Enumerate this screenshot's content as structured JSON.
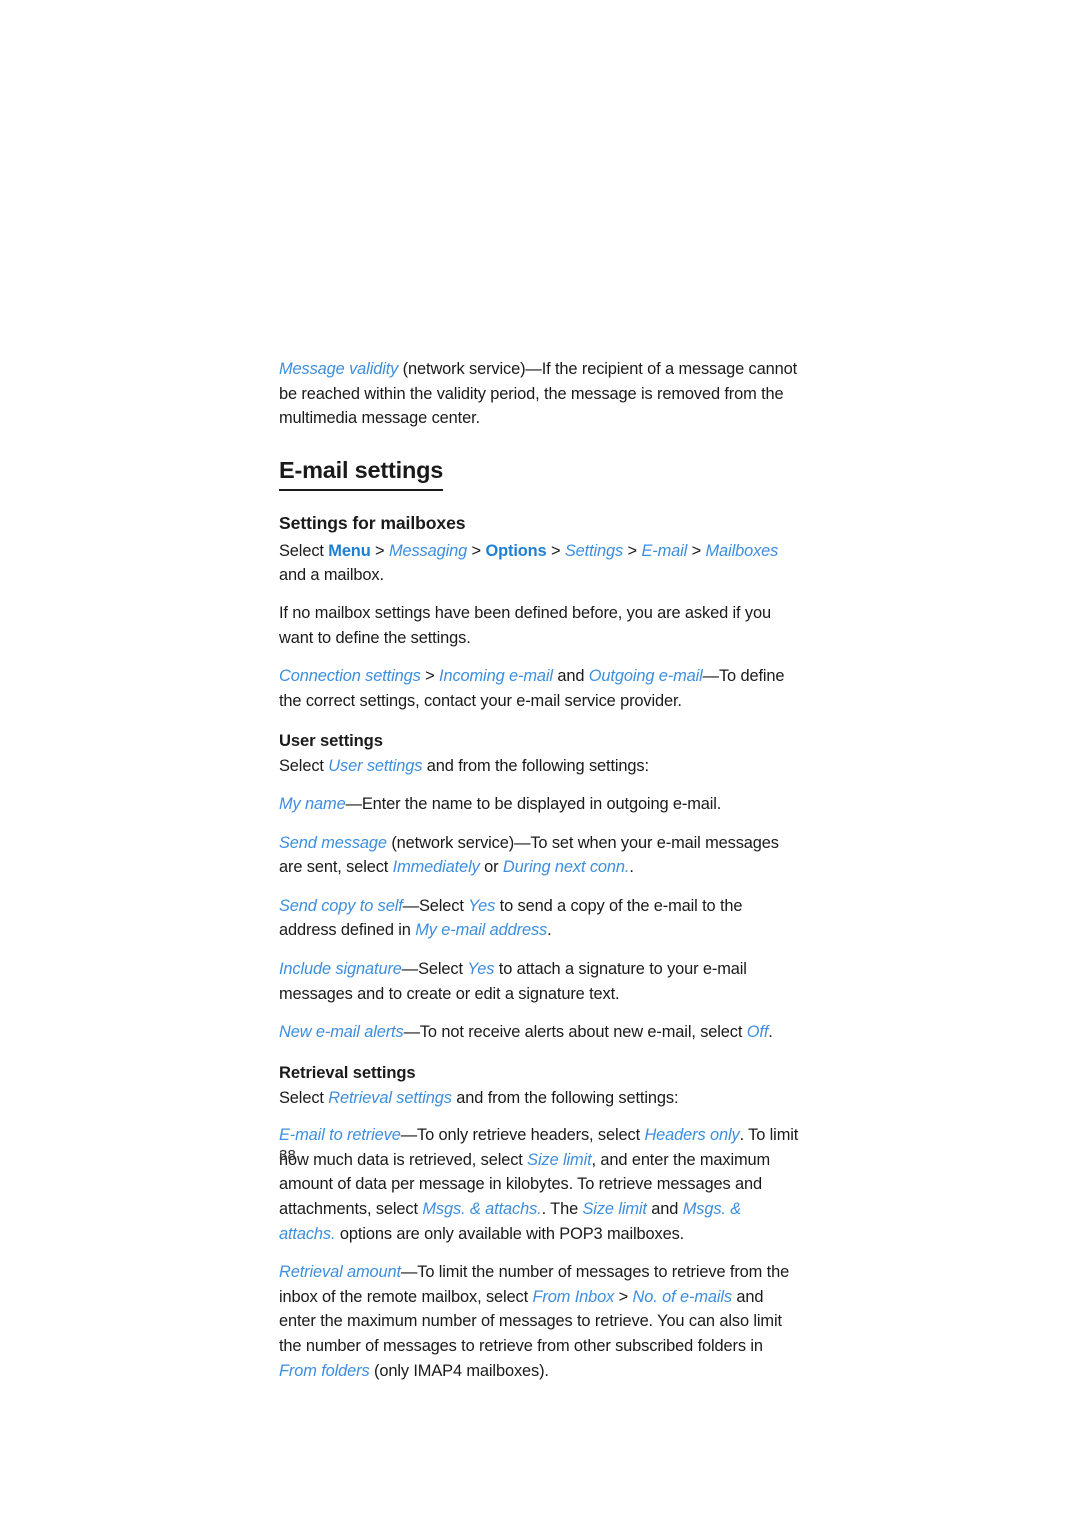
{
  "document": {
    "page_number": "38",
    "accent_blue": "#3d8ede",
    "key_blue": "#1d7fd4",
    "body_color": "#1a1a1a"
  },
  "intro_paragraph": {
    "term": "Message validity",
    "rest": " (network service)—If the recipient of a message cannot be reached within the validity period, the message is removed from the multimedia message center."
  },
  "section": {
    "title": "E-mail settings"
  },
  "mailboxes": {
    "subtitle": "Settings for mailboxes",
    "select_label": "Select ",
    "path": {
      "menu": "Menu",
      "messaging": "Messaging",
      "options": "Options",
      "settings": "Settings",
      "email": "E-mail",
      "mailboxes": "Mailboxes",
      "tail": " and a mailbox.",
      "separator": " > "
    },
    "no_settings_paragraph": "If no mailbox settings have been defined before, you are asked if you want to define the settings.",
    "connection": {
      "term1": "Connection settings",
      "separator": " > ",
      "term2": "Incoming e-mail",
      "conj": " and ",
      "term3": "Outgoing e-mail",
      "rest": "—To define the correct settings, contact your e-mail service provider."
    }
  },
  "user_settings": {
    "heading": "User settings",
    "lead_prefix": "Select ",
    "lead_term": "User settings",
    "lead_suffix": " and from the following settings:",
    "items": {
      "my_name": {
        "term": "My name",
        "rest": "—Enter the name to be displayed in outgoing e-mail."
      },
      "send_message": {
        "term": "Send message",
        "mid": " (network service)—To set when your e-mail messages are sent, select ",
        "opt1": "Immediately",
        "conj": " or ",
        "opt2": "During next conn.",
        "end": "."
      },
      "send_copy": {
        "term": "Send copy to self",
        "mid1": "—Select ",
        "opt1": "Yes",
        "mid2": " to send a copy of the e-mail to the address defined in ",
        "opt2": "My e-mail address",
        "end": "."
      },
      "include_signature": {
        "term": "Include signature",
        "mid1": "—Select ",
        "opt1": "Yes",
        "rest": " to attach a signature to your e-mail messages and to create or edit a signature text."
      },
      "new_alerts": {
        "term": "New e-mail alerts",
        "mid": "—To not receive alerts about new e-mail, select ",
        "opt": "Off",
        "end": "."
      }
    }
  },
  "retrieval_settings": {
    "heading": "Retrieval settings",
    "lead_prefix": "Select ",
    "lead_term": "Retrieval settings",
    "lead_suffix": " and from the following settings:",
    "email_to_retrieve": {
      "term": "E-mail to retrieve",
      "p1": "—To only retrieve headers, select ",
      "opt1": "Headers only",
      "p2": ". To limit how much data is retrieved, select ",
      "opt2": "Size limit",
      "p3": ", and enter the maximum amount of data per message in kilobytes. To retrieve messages and attachments, select ",
      "opt3": "Msgs. & attachs.",
      "p4": ". The ",
      "opt4": "Size limit",
      "p5": " and ",
      "opt5": "Msgs. & attachs.",
      "p6": " options are only available with POP3 mailboxes."
    },
    "retrieval_amount": {
      "term": "Retrieval amount",
      "p1": "—To limit the number of messages to retrieve from the inbox of the remote mailbox, select ",
      "opt1": "From Inbox",
      "sep": " > ",
      "opt2": "No. of e-mails",
      "p2": " and enter the maximum number of messages to retrieve. You can also limit the number of messages to retrieve from other subscribed folders in ",
      "opt3": "From folders",
      "p3": " (only IMAP4 mailboxes)."
    }
  }
}
